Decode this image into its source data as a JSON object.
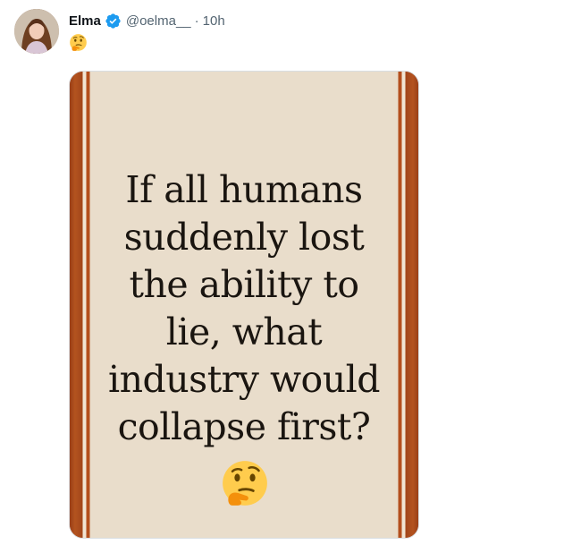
{
  "tweet": {
    "author": {
      "name": "Elma",
      "handle": "@oelma__",
      "separator": "·",
      "time": "10h",
      "verified": true,
      "verified_icon": "verified-badge-icon",
      "avatar_icon": "avatar-photo"
    },
    "text_emoji": "thinking-face-emoji",
    "media": {
      "question": "If all humans\nsuddenly lost\nthe ability to\nlie, what\nindustry would\ncollapse first?",
      "emoji": "thinking-face-emoji",
      "colors": {
        "background": "#e9ddcb",
        "border": "#b44f1d",
        "text": "#1a1510"
      }
    }
  },
  "colors": {
    "name": "#0f1419",
    "secondary": "#536471",
    "verified": "#1d9bf0"
  }
}
